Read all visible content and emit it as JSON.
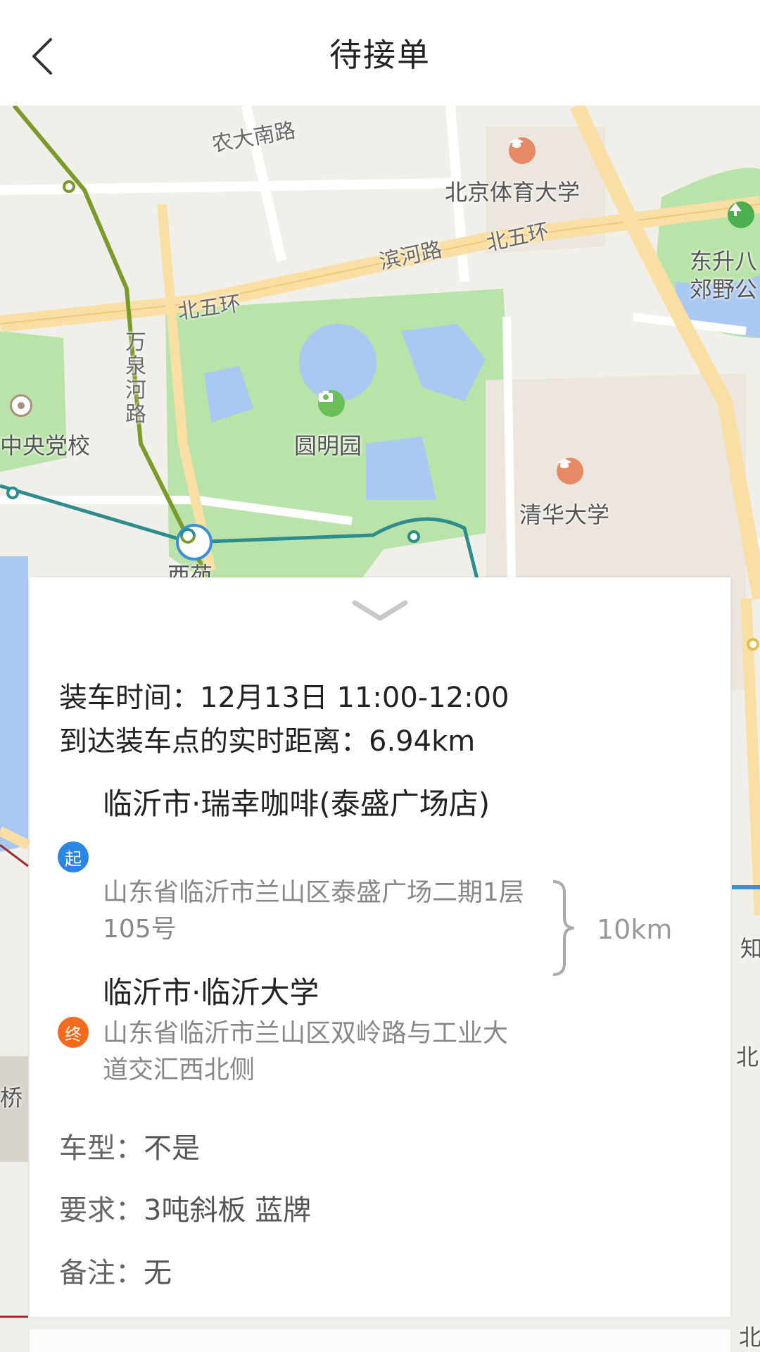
{
  "header": {
    "title": "待接单",
    "back_icon": "chevron-left-icon"
  },
  "map": {
    "labels": {
      "nongda": "农大南路",
      "tiyu": "北京体育大学",
      "binhe": "滨河路",
      "beiwuhuan_right": "北五环",
      "beiwuhuan_left": "北五环",
      "wanquan": "万泉河路",
      "dongsheng": "东升八",
      "jiaoye": "郊野公",
      "zhongyang": "中央党校",
      "yuanmingyuan": "圆明园",
      "qinghua": "清华大学",
      "xiyuan": "西苑",
      "zhi": "知",
      "bei_right": "北三",
      "qiao": "桥",
      "bei_bottom": "北"
    },
    "colors": {
      "park": "#b9e3a8",
      "water": "#a9c8f2",
      "road": "#ffffff",
      "highway": "#f9dfa3",
      "bg": "#f1efe9"
    }
  },
  "card": {
    "collapse_icon": "chevron-down-icon",
    "loading_time_label": "装车时间：",
    "loading_time_value": "12月13日 11:00-12:00",
    "distance_label": "到达装车点的实时距离：",
    "distance_value": "6.94km",
    "start": {
      "icon_text": "起",
      "name": "临沂市·瑞幸咖啡(泰盛广场店)",
      "address": "山东省临沂市兰山区泰盛广场二期1层105号",
      "color": "#2a86e4"
    },
    "end": {
      "icon_text": "终",
      "name": "临沂市·临沂大学",
      "address": "山东省临沂市兰山区双岭路与工业大道交汇西北侧",
      "color": "#f26b1f"
    },
    "route_distance": "10km",
    "vehicle_label": "车型：",
    "vehicle_value": "不是",
    "requirement_label": "要求：",
    "requirement_value": "3吨斜板 蓝牌",
    "remark_label": "备注：",
    "remark_value": "无"
  }
}
